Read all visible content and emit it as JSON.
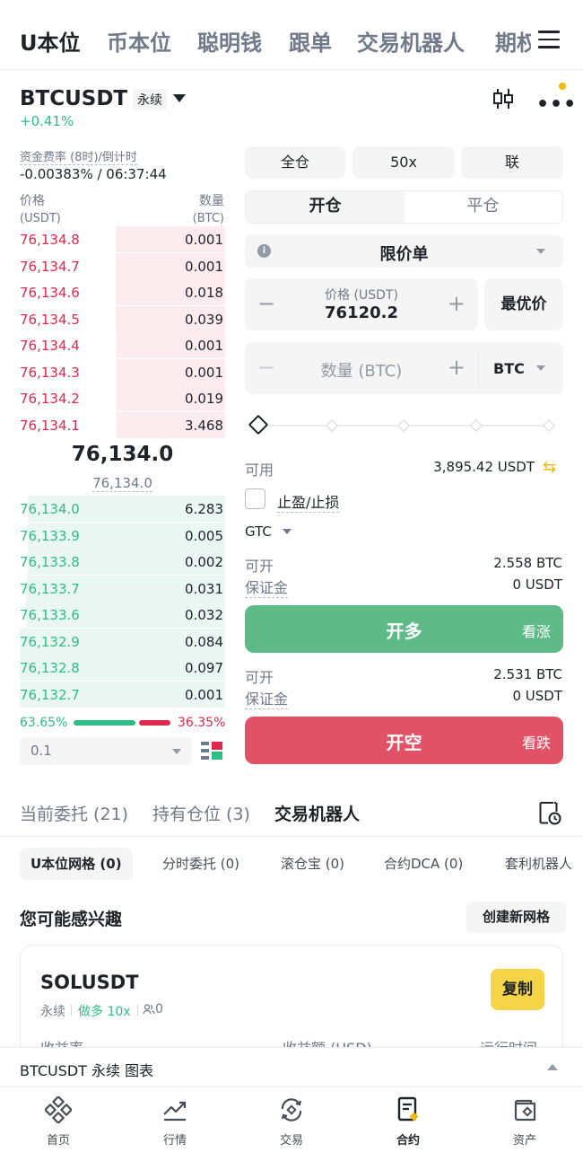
{
  "top_tabs": [
    "U本位",
    "币本位",
    "聪明钱",
    "跟单",
    "交易机器人",
    "期权"
  ],
  "header": {
    "symbol": "BTCUSDT",
    "contract_type": "永续",
    "change": "+0.41%"
  },
  "funding": {
    "label": "资金费率 (8时)/倒计时",
    "value": "-0.00383% / 06:37:44"
  },
  "orderbook": {
    "price_header": "价格",
    "price_unit": "(USDT)",
    "qty_header": "数量",
    "qty_unit": "(BTC)",
    "asks": [
      {
        "price": "76,134.8",
        "qty": "0.001"
      },
      {
        "price": "76,134.7",
        "qty": "0.001"
      },
      {
        "price": "76,134.6",
        "qty": "0.018"
      },
      {
        "price": "76,134.5",
        "qty": "0.039"
      },
      {
        "price": "76,134.4",
        "qty": "0.001"
      },
      {
        "price": "76,134.3",
        "qty": "0.001"
      },
      {
        "price": "76,134.2",
        "qty": "0.019"
      },
      {
        "price": "76,134.1",
        "qty": "3.468"
      }
    ],
    "last_price": "76,134.0",
    "mark_price": "76,134.0",
    "bids": [
      {
        "price": "76,134.0",
        "qty": "6.283"
      },
      {
        "price": "76,133.9",
        "qty": "0.005"
      },
      {
        "price": "76,133.8",
        "qty": "0.002"
      },
      {
        "price": "76,133.7",
        "qty": "0.031"
      },
      {
        "price": "76,133.6",
        "qty": "0.032"
      },
      {
        "price": "76,132.9",
        "qty": "0.084"
      },
      {
        "price": "76,132.8",
        "qty": "0.097"
      },
      {
        "price": "76,132.7",
        "qty": "0.001"
      }
    ],
    "buy_ratio": "63.65%",
    "sell_ratio": "36.35%",
    "buy_ratio_value": 0.6365,
    "precision": "0.1"
  },
  "form": {
    "margin_mode": "全仓",
    "leverage": "50x",
    "asset_mode": "联",
    "tab_open": "开仓",
    "tab_close": "平仓",
    "order_type": "限价单",
    "price_label": "价格 (USDT)",
    "price_value": "76120.2",
    "bbo": "最优价",
    "qty_placeholder": "数量 (BTC)",
    "qty_unit": "BTC",
    "available_label": "可用",
    "available_value": "3,895.42 USDT",
    "tpsl_label": "止盈/止损",
    "tif": "GTC",
    "long": {
      "can_open_label": "可开",
      "can_open_value": "2.558 BTC",
      "margin_label": "保证金",
      "margin_value": "0 USDT",
      "button": "开多",
      "side": "看涨"
    },
    "short": {
      "can_open_label": "可开",
      "can_open_value": "2.531 BTC",
      "margin_label": "保证金",
      "margin_value": "0 USDT",
      "button": "开空",
      "side": "看跌"
    }
  },
  "section_tabs": [
    "当前委托 (21)",
    "持有仓位 (3)",
    "交易机器人"
  ],
  "bot_chips": [
    "U本位网格 (0)",
    "分时委托 (0)",
    "滚仓宝 (0)",
    "合约DCA (0)",
    "套利机器人"
  ],
  "interest": {
    "title": "您可能感兴趣",
    "create_button": "创建新网格"
  },
  "bot_card": {
    "symbol": "SOLUSDT",
    "tag_contract": "永续",
    "tag_direction": "做多 10x",
    "users": "0",
    "copy_button": "复制",
    "col1": "收益率",
    "col2": "收益额 (USD)",
    "col3": "运行时间"
  },
  "chart_bar": {
    "label": "BTCUSDT 永续 图表"
  },
  "bottom_nav": [
    {
      "label": "首页",
      "icon": "home-icon"
    },
    {
      "label": "行情",
      "icon": "markets-icon"
    },
    {
      "label": "交易",
      "icon": "trade-icon"
    },
    {
      "label": "合约",
      "icon": "futures-icon"
    },
    {
      "label": "资产",
      "icon": "wallet-icon"
    }
  ],
  "colors": {
    "green": "#2ebd85",
    "red": "#e0294a",
    "long_button": "#5ebb87",
    "short_button": "#e25266",
    "accent": "#f0b90b"
  }
}
